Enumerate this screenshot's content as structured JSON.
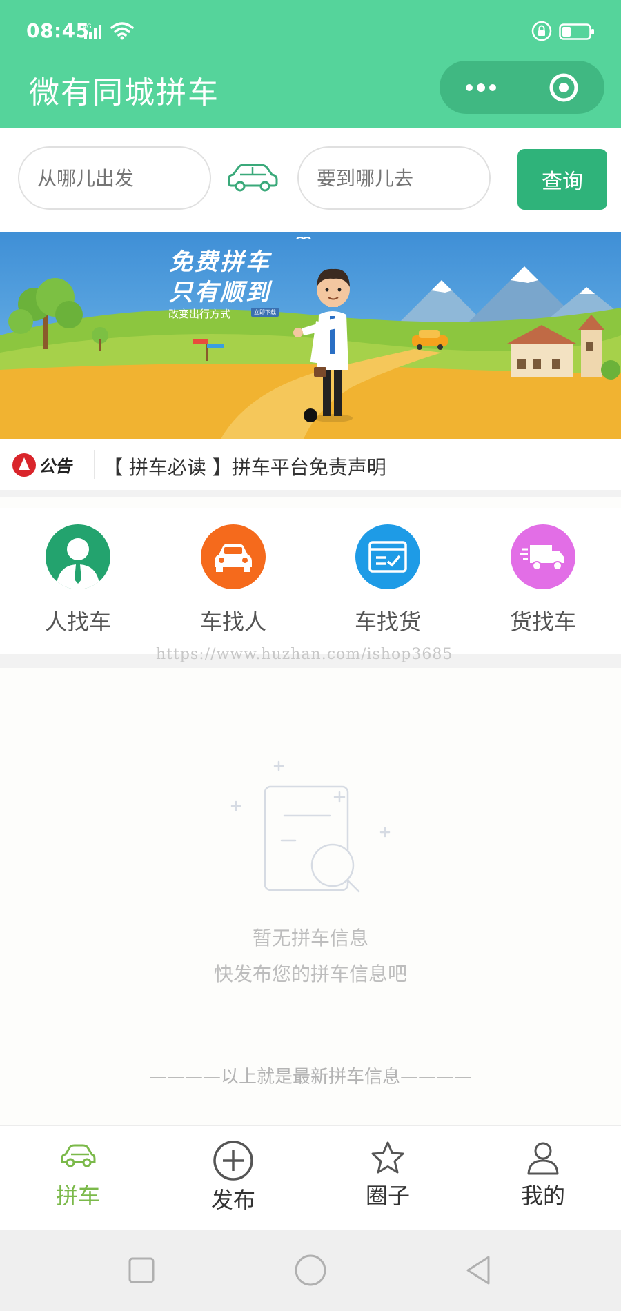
{
  "status_bar": {
    "time": "08:45",
    "network": "4G"
  },
  "header": {
    "title": "微有同城拼车",
    "background": "#55d49b"
  },
  "search": {
    "from_placeholder": "从哪儿出发",
    "to_placeholder": "要到哪儿去",
    "query_label": "查询"
  },
  "banner": {
    "line1": "免费拼车",
    "line2": "只有顺到",
    "sub": "改变出行方式",
    "tag": "立即下载"
  },
  "notice": {
    "logo_text": "公告",
    "text": "【 拼车必读 】拼车平台免责声明"
  },
  "categories": [
    {
      "label": "人找车",
      "color": "#23a36e",
      "icon": "person-icon"
    },
    {
      "label": "车找人",
      "color": "#f56a1c",
      "icon": "car-icon"
    },
    {
      "label": "车找货",
      "color": "#1e9be6",
      "icon": "cargo-card-icon"
    },
    {
      "label": "货找车",
      "color": "#e26ee6",
      "icon": "truck-icon"
    }
  ],
  "watermark": "https://www.huzhan.com/ishop3685",
  "empty": {
    "line1": "暂无拼车信息",
    "line2": "快发布您的拼车信息吧",
    "latest": "————以上就是最新拼车信息————"
  },
  "tabbar": {
    "items": [
      {
        "label": "拼车",
        "icon": "car-icon",
        "active": true
      },
      {
        "label": "发布",
        "icon": "plus-circle-icon",
        "active": false
      },
      {
        "label": "圈子",
        "icon": "star-icon",
        "active": false
      },
      {
        "label": "我的",
        "icon": "user-icon",
        "active": false
      }
    ],
    "active_color": "#7bb94a"
  }
}
